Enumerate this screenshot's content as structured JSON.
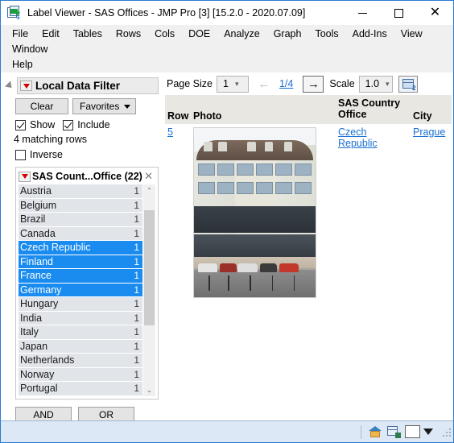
{
  "window": {
    "title": "Label Viewer - SAS Offices - JMP Pro [3] [15.2.0 - 2020.07.09]",
    "app_icon": "jmp-data-table-icon",
    "minimize": "–",
    "maximize": "□",
    "close": "✕"
  },
  "menubar": {
    "items": [
      {
        "label": "File"
      },
      {
        "label": "Edit"
      },
      {
        "label": "Tables"
      },
      {
        "label": "Rows"
      },
      {
        "label": "Cols"
      },
      {
        "label": "DOE"
      },
      {
        "label": "Analyze"
      },
      {
        "label": "Graph"
      },
      {
        "label": "Tools"
      },
      {
        "label": "Add-Ins"
      },
      {
        "label": "View"
      },
      {
        "label": "Window"
      },
      {
        "label": "Help"
      }
    ]
  },
  "toolbar": {
    "buttons": [
      {
        "name": "new-data-table-icon"
      },
      {
        "name": "columns-icon"
      },
      {
        "name": "add-data-table-icon"
      }
    ],
    "overflow": "▼"
  },
  "filter_panel": {
    "title": "Local Data Filter",
    "menu_icon": "red-triangle-menu-icon",
    "clear_label": "Clear",
    "favorites_label": "Favorites",
    "show_label": "Show",
    "show_checked": true,
    "include_label": "Include",
    "include_checked": true,
    "matching_rows": "4 matching rows",
    "inverse_label": "Inverse",
    "inverse_checked": false,
    "card": {
      "title": "SAS Count...Office (22)",
      "close_label": "✕",
      "items": [
        {
          "label": "Austria",
          "count": "1",
          "selected": false
        },
        {
          "label": "Belgium",
          "count": "1",
          "selected": false
        },
        {
          "label": "Brazil",
          "count": "1",
          "selected": false
        },
        {
          "label": "Canada",
          "count": "1",
          "selected": false
        },
        {
          "label": "Czech Republic",
          "count": "1",
          "selected": true
        },
        {
          "label": "Finland",
          "count": "1",
          "selected": true
        },
        {
          "label": "France",
          "count": "1",
          "selected": true
        },
        {
          "label": "Germany",
          "count": "1",
          "selected": true
        },
        {
          "label": "Hungary",
          "count": "1",
          "selected": false
        },
        {
          "label": "India",
          "count": "1",
          "selected": false
        },
        {
          "label": "Italy",
          "count": "1",
          "selected": false
        },
        {
          "label": "Japan",
          "count": "1",
          "selected": false
        },
        {
          "label": "Netherlands",
          "count": "1",
          "selected": false
        },
        {
          "label": "Norway",
          "count": "1",
          "selected": false
        },
        {
          "label": "Portugal",
          "count": "1",
          "selected": false
        }
      ],
      "scroll_up": "⌃",
      "scroll_down": "⌄"
    },
    "and_label": "AND",
    "or_label": "OR"
  },
  "page_bar": {
    "page_size_label": "Page Size",
    "page_size_value": "1",
    "prev_icon": "arrow-left-icon",
    "prev_enabled": false,
    "page_indicator": "1/4",
    "next_icon": "arrow-right-icon",
    "next_enabled": true,
    "scale_label": "Scale",
    "scale_value": "1.0",
    "layout_icon": "table-layout-icon"
  },
  "table": {
    "headers": [
      "Row",
      "Photo",
      "SAS Country Office",
      "City"
    ],
    "rows": [
      {
        "row": "5",
        "photo": "sas-office-building-photo",
        "office": "Czech Republic",
        "city": "Prague"
      }
    ]
  },
  "status_bar": {
    "home_icon": "home-icon",
    "table_icon": "data-table-icon",
    "color_swatch": "#ffffff",
    "dropdown_icon": "caret-down-icon",
    "resize_grip": "resize-grip-icon"
  },
  "colors": {
    "selection": "#1a8cf0",
    "link": "#1a6fd4",
    "window_border": "#2b7cd3",
    "status_bg": "#dce8f5",
    "header_bg": "#e9e7e2",
    "list_row_bg": "#e1e4e9"
  }
}
